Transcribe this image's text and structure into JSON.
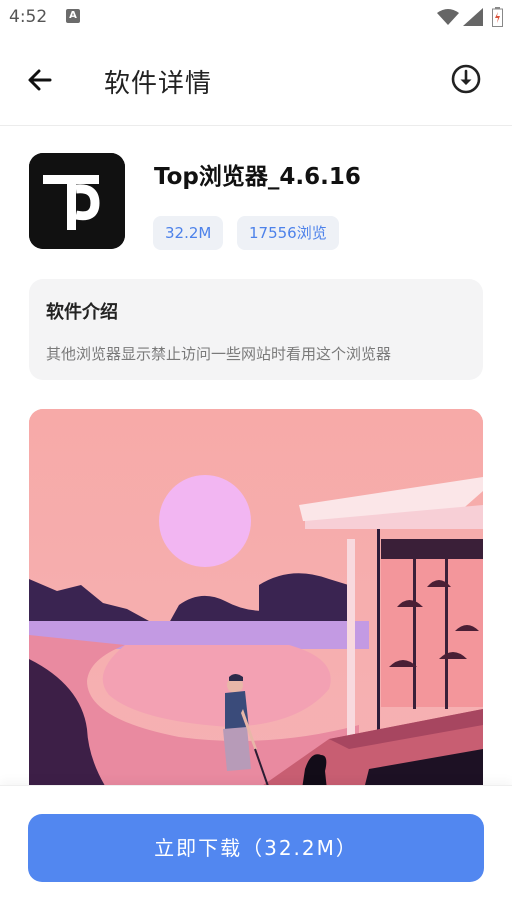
{
  "status_bar": {
    "time": "4:52",
    "icons": [
      "a-notification-icon",
      "wifi-icon",
      "signal-icon",
      "battery-icon"
    ]
  },
  "app_bar": {
    "title": "软件详情",
    "back_icon": "back-arrow-icon",
    "download_icon": "download-circle-icon"
  },
  "app": {
    "name": "Top浏览器_4.6.16",
    "size_chip": "32.2M",
    "views_chip": "17556浏览",
    "icon": "app-logo-icon"
  },
  "intro": {
    "title": "软件介绍",
    "text": "其他浏览器显示禁止访问一些网站时看用这个浏览器"
  },
  "screenshot": {
    "name": "app-screenshot-illustration"
  },
  "download_button": {
    "label": "立即下载（32.2M）"
  },
  "colors": {
    "accent": "#5287f0",
    "chip_text": "#4d82ea",
    "chip_bg": "#eef1f6",
    "card_bg": "#f4f4f5"
  }
}
